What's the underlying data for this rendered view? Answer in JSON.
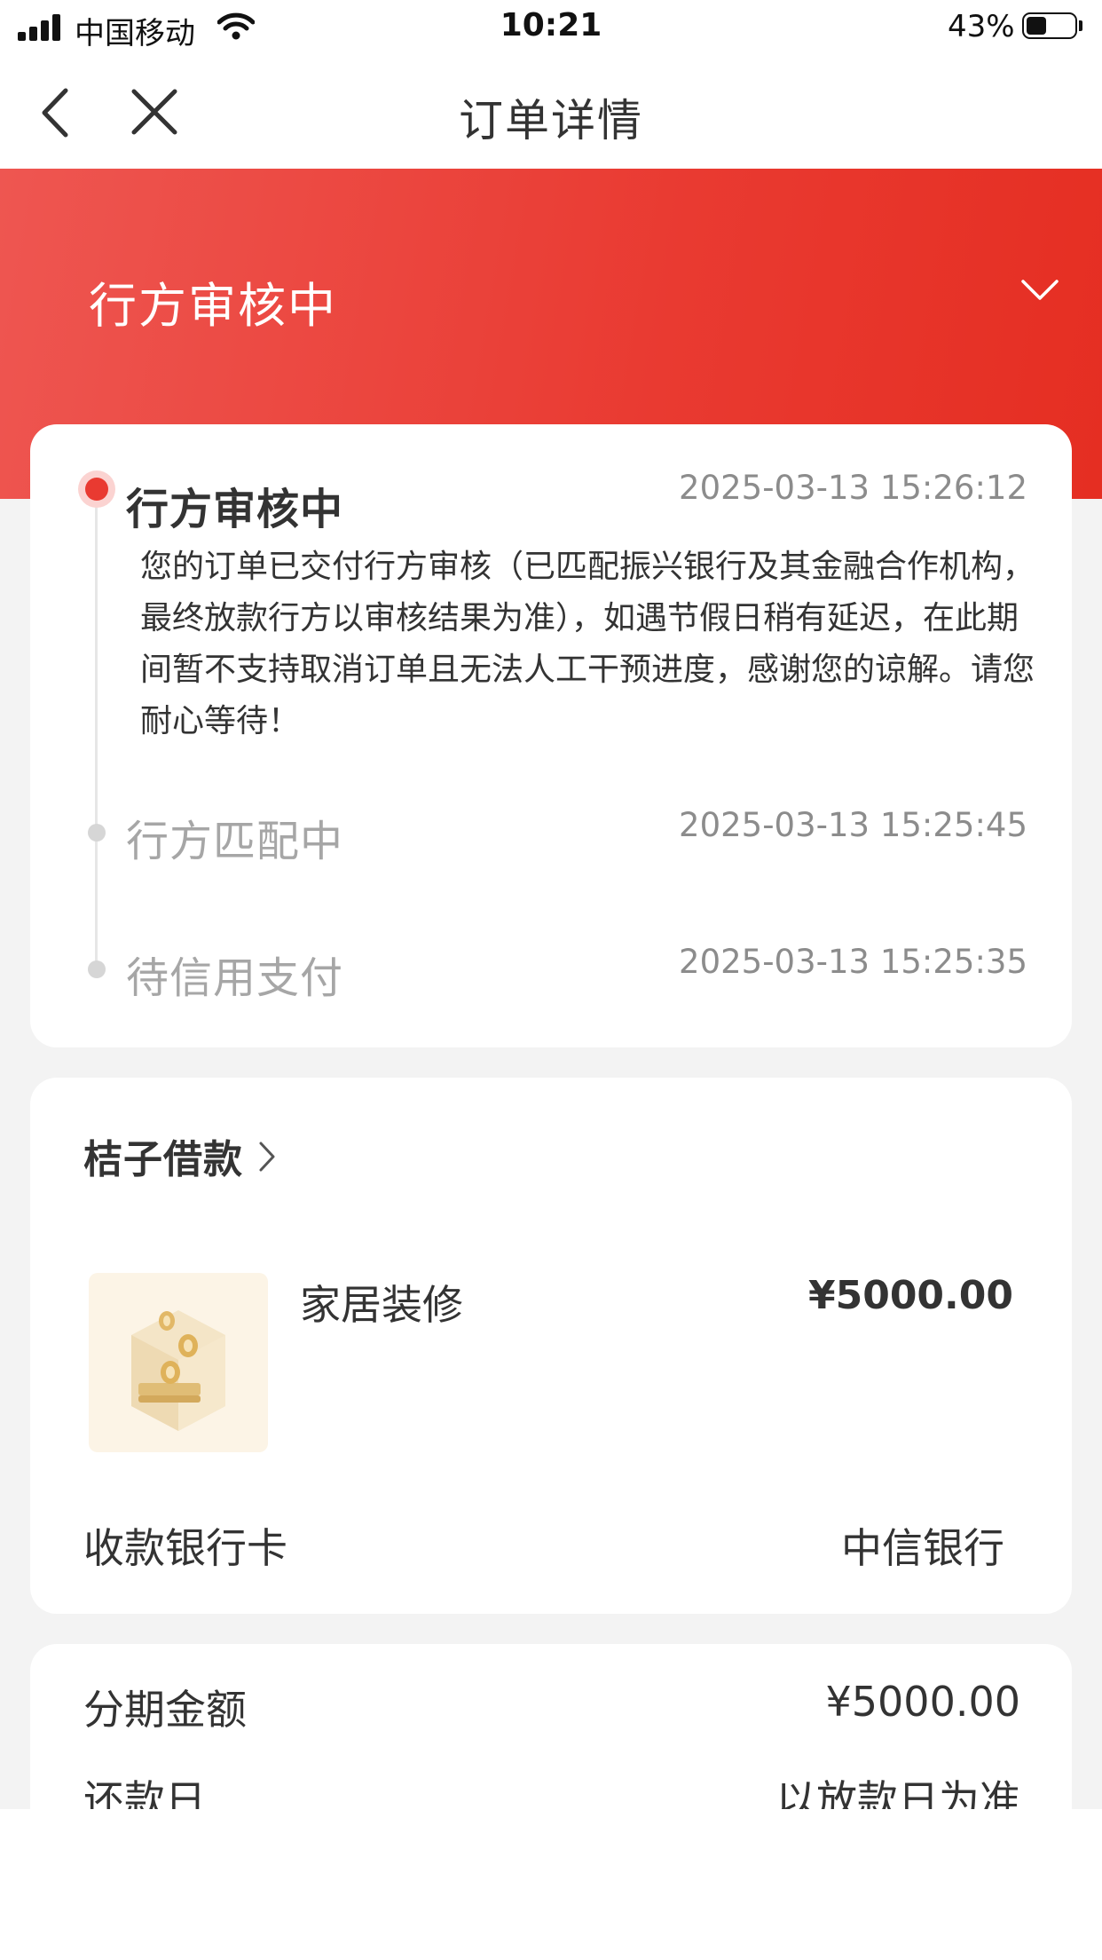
{
  "status_bar": {
    "carrier": "中国移动",
    "time": "10:21",
    "battery": "43%",
    "battery_level": 0.43
  },
  "nav": {
    "title": "订单详情"
  },
  "header": {
    "status": "行方审核中"
  },
  "timeline": [
    {
      "title": "行方审核中",
      "time": "2025-03-13 15:26:12",
      "description": "您的订单已交付行方审核（已匹配振兴银行及其金融合作机构，最终放款行方以审核结果为准），如遇节假日稍有延迟，在此期间暂不支持取消订单且无法人工干预进度，感谢您的谅解。请您耐心等待！"
    },
    {
      "title": "行方匹配中",
      "time": "2025-03-13 15:25:45"
    },
    {
      "title": "待信用支付",
      "time": "2025-03-13 15:25:35"
    }
  ],
  "product_card": {
    "merchant": "桔子借款",
    "item_name": "家居装修",
    "item_price": "¥5000.00",
    "bank_card_label": "收款银行卡",
    "bank_card_value": "中信银行"
  },
  "installment_card": {
    "amount_label": "分期金额",
    "amount_value": "¥5000.00",
    "repay_label": "还款日",
    "repay_value": "以放款日为准"
  },
  "colors": {
    "accent": "#e93a31",
    "background": "#f3f3f3"
  }
}
